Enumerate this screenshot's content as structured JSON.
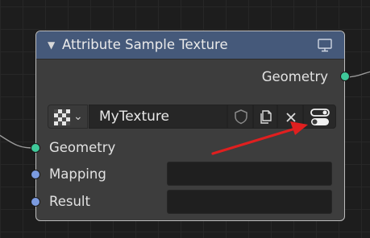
{
  "node": {
    "title": "Attribute Sample Texture",
    "collapse_icon": "triangle-down-icon",
    "header_icon": "monitor-icon",
    "header_color": "#45597a",
    "outputs": [
      {
        "label": "Geometry",
        "socket_color": "#3fc99a"
      }
    ],
    "texture": {
      "preview_icon": "checkerboard-icon",
      "dropdown_icon": "chevron-down-icon",
      "name": "MyTexture",
      "buttons": [
        "fake-user-shield-icon",
        "duplicate-icon",
        "unlink-x-icon",
        "properties-toggle-icon"
      ]
    },
    "inputs": [
      {
        "label": "Geometry",
        "socket_color": "#3fc99a"
      },
      {
        "label": "Mapping",
        "socket_color": "#7b9be0",
        "value": ""
      },
      {
        "label": "Result",
        "socket_color": "#7b9be0",
        "value": ""
      }
    ]
  },
  "annotation": {
    "arrow_color": "#e01f1f",
    "points_to": "properties-toggle-icon"
  }
}
